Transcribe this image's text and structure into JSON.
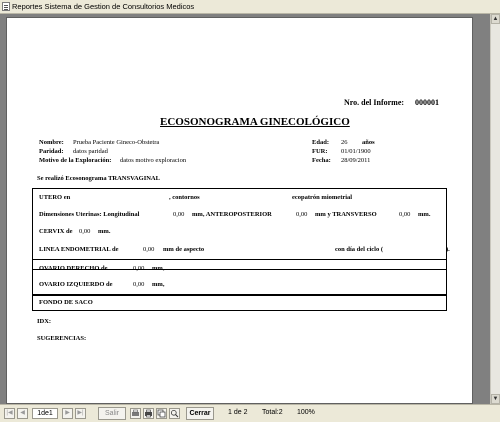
{
  "window": {
    "title": "Reportes Sistema de Gestion de Consultorios Medicos"
  },
  "report": {
    "informe_label": "Nro. del Informe:",
    "informe_value": "000001",
    "heading": "ECOSONOGRAMA GINECOLÓGICO",
    "nombre_label": "Nombre:",
    "nombre_value": "Prueba Paciente Gineco-Obstetra",
    "paridad_label": "Paridad:",
    "paridad_value": "datos paridad",
    "motivo_label": "Motivo de la Exploración:",
    "motivo_value": "datos motivo exploracion",
    "edad_label": "Edad:",
    "edad_value": "26",
    "edad_unit": "años",
    "fur_label": "FUR:",
    "fur_value": "01/01/1900",
    "fecha_label": "Fecha:",
    "fecha_value": "28/09/2011",
    "realizo": "Se realizó Ecosonograma TRANSVAGINAL",
    "utero_label": "UTERO en",
    "contornos_label": ", contornos",
    "ecopatron_label": "ecopatrón miometrial",
    "dimensiones_label": "Dimensiones Uterinas: Longitudinal",
    "longitudinal_value": "0,00",
    "antero_label": "mm, ANTEROPOSTERIOR",
    "antero_value": "0,00",
    "transverso_label": "mm y TRANSVERSO",
    "transverso_value": "0,00",
    "mm_period": "mm.",
    "cervix_label": "CERVIX de",
    "cervix_value": "0,00",
    "linea_label": "LINEA ENDOMETRIAL de",
    "linea_value": "0,00",
    "aspecto_label": "mm de aspecto",
    "dia_ciclo_label": "con día del ciclo (",
    "dia_ciclo_close": ").",
    "ovario_der_label": "OVARIO DERECHO de",
    "ovario_der_value": "0,00",
    "ovario_izq_label": "OVARIO IZQUIERDO de",
    "ovario_izq_value": "0,00",
    "mm_comma": "mm,",
    "fondo_label": "FONDO DE SACO",
    "idx_label": "IDX:",
    "sugerencias_label": "SUGERENCIAS:"
  },
  "toolbar": {
    "page_field": "1de1",
    "salir_label": "Salir",
    "cerrar_label": "Cerrar",
    "page_status": "1 de 2",
    "total_label": "Total:2",
    "zoom_label": "100%"
  }
}
